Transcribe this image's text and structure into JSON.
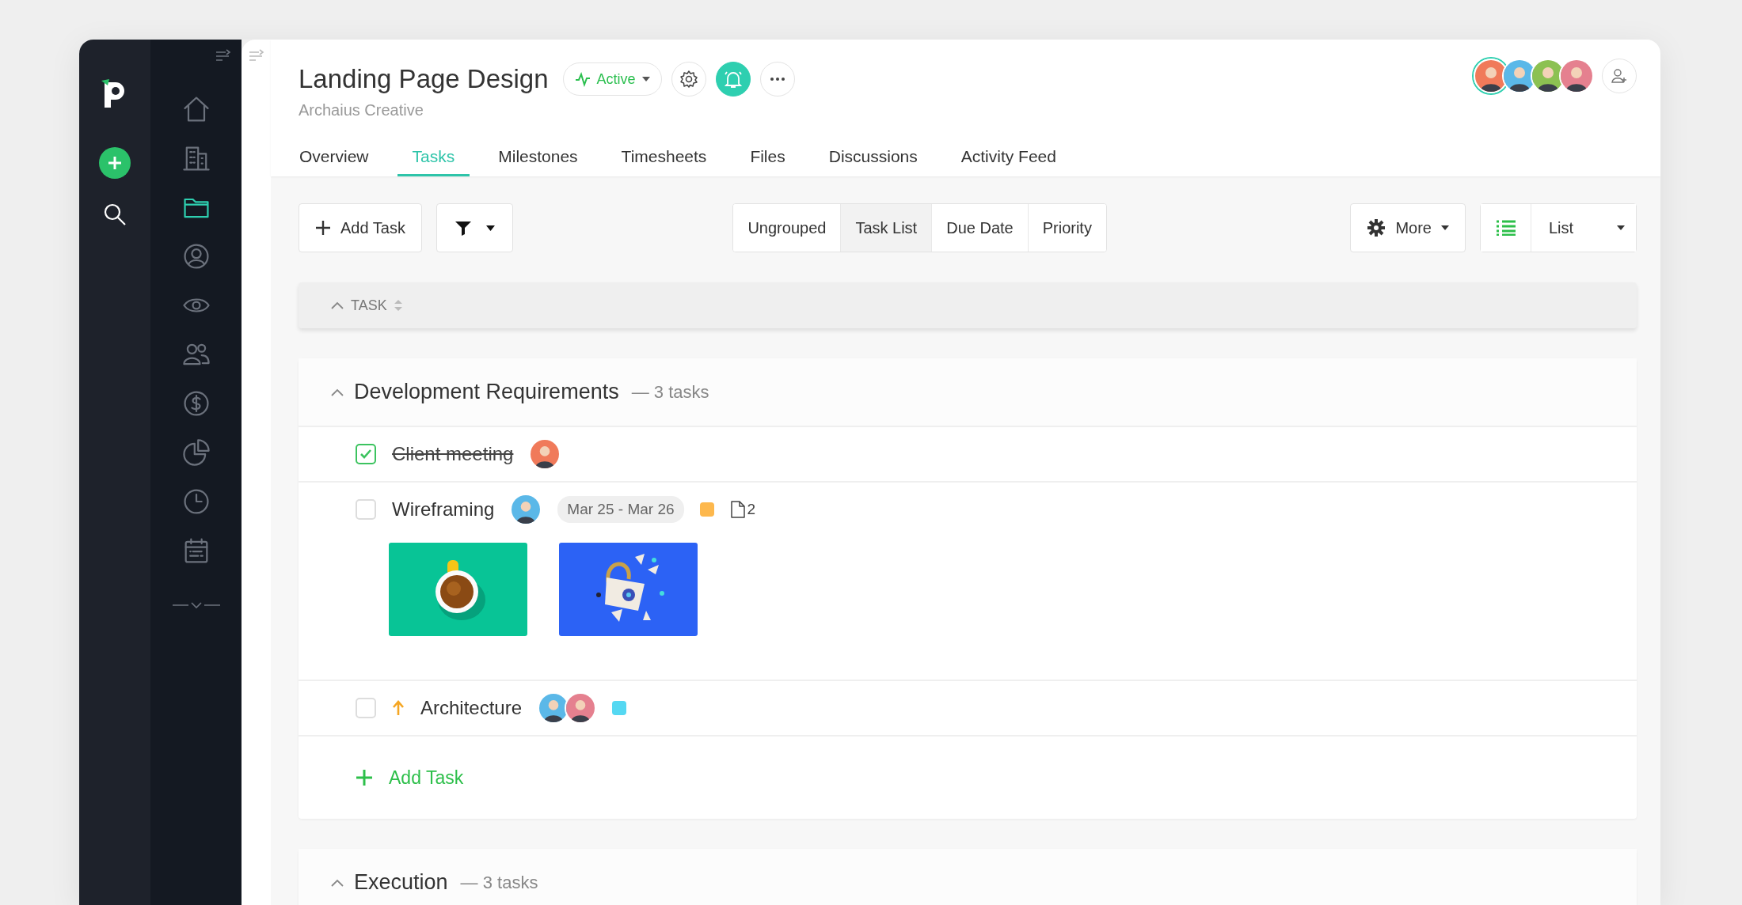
{
  "nav_items": [
    {
      "selected": false
    },
    {
      "selected": false
    },
    {
      "selected": true
    },
    {
      "selected": false
    },
    {
      "selected": false
    },
    {
      "selected": false
    },
    {
      "selected": false
    },
    {
      "selected": false
    },
    {
      "selected": false
    },
    {
      "selected": false
    }
  ],
  "project": {
    "title": "Landing Page Design",
    "client": "Archaius Creative",
    "status": "Active"
  },
  "members": [
    {
      "color": "#f07a5a",
      "selected": true
    },
    {
      "color": "#5bb8e8",
      "selected": false
    },
    {
      "color": "#8cc152",
      "selected": false
    },
    {
      "color": "#e5808f",
      "selected": false
    }
  ],
  "tabs": [
    {
      "label": "Overview",
      "selected": false
    },
    {
      "label": "Tasks",
      "selected": true
    },
    {
      "label": "Milestones",
      "selected": false
    },
    {
      "label": "Timesheets",
      "selected": false
    },
    {
      "label": "Files",
      "selected": false
    },
    {
      "label": "Discussions",
      "selected": false
    },
    {
      "label": "Activity Feed",
      "selected": false
    }
  ],
  "toolbar": {
    "add_task": "Add Task",
    "groupings": [
      {
        "label": "Ungrouped",
        "selected": false
      },
      {
        "label": "Task List",
        "selected": true
      },
      {
        "label": "Due Date",
        "selected": false
      },
      {
        "label": "Priority",
        "selected": false
      }
    ],
    "more": "More",
    "view": "List"
  },
  "table_header": {
    "column": "TASK"
  },
  "sections": [
    {
      "title": "Development Requirements",
      "count": "— 3 tasks",
      "expanded": true,
      "tasks": [
        {
          "name": "Client meeting",
          "done": true,
          "priority_high": false,
          "assignees": [
            {
              "color": "#f07a5a"
            }
          ]
        },
        {
          "name": "Wireframing",
          "done": false,
          "priority_high": false,
          "assignees": [
            {
              "color": "#5bb8e8"
            }
          ],
          "date": "Mar 25 - Mar 26",
          "color": "#fdb84d",
          "attachments": "2",
          "pictures": [
            {
              "kind": "picture"
            },
            {
              "kind": "picture"
            }
          ]
        },
        {
          "name": "Architecture",
          "done": false,
          "priority_high": true,
          "assignees": [
            {
              "color": "#5bb8e8"
            },
            {
              "color": "#e5808f"
            }
          ],
          "color": "#55d8f2"
        }
      ],
      "add_task": "Add Task"
    },
    {
      "title": "Execution",
      "count": "— 3 tasks",
      "expanded": true
    }
  ]
}
